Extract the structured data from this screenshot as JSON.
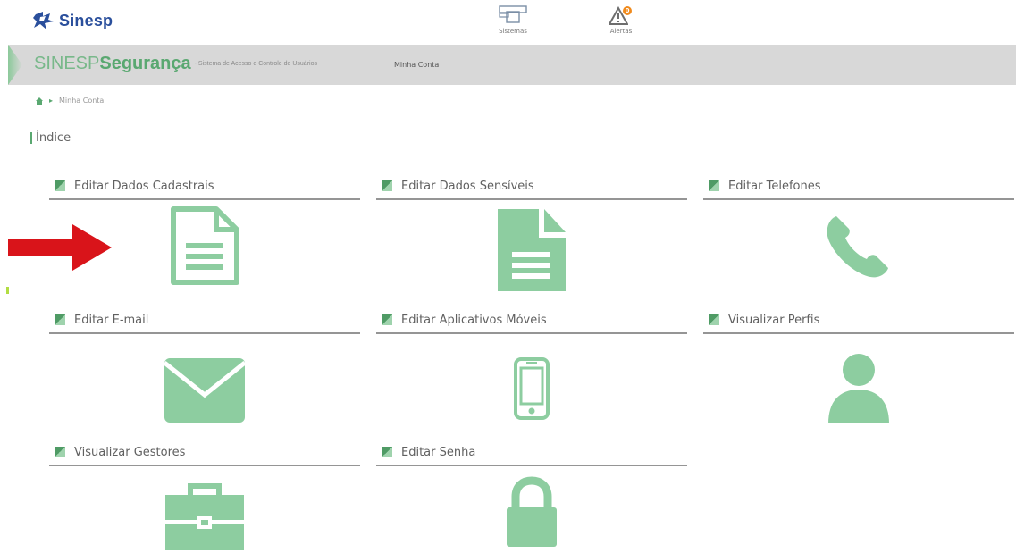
{
  "header": {
    "logo_text": "Sinesp",
    "systems_label": "Sistemas",
    "alerts_label": "Alertas",
    "alerts_count": "0"
  },
  "nav": {
    "brand_prefix": "SINESP",
    "brand_bold": "Segurança",
    "brand_subtitle": "- Sistema de Acesso e Controle de Usuários",
    "menu_item": "Minha Conta"
  },
  "breadcrumb": {
    "current": "Minha Conta"
  },
  "page": {
    "title": "Índice"
  },
  "cards": [
    {
      "label": "Editar Dados Cadastrais",
      "icon": "document-outline-icon"
    },
    {
      "label": "Editar Dados Sensíveis",
      "icon": "document-filled-icon"
    },
    {
      "label": "Editar Telefones",
      "icon": "phone-icon"
    },
    {
      "label": "Editar E-mail",
      "icon": "envelope-icon"
    },
    {
      "label": "Editar Aplicativos Móveis",
      "icon": "mobile-phone-icon"
    },
    {
      "label": "Visualizar Perfis",
      "icon": "user-icon"
    },
    {
      "label": "Visualizar Gestores",
      "icon": "briefcase-icon"
    },
    {
      "label": "Editar Senha",
      "icon": "padlock-icon"
    }
  ],
  "colors": {
    "icon_green": "#8dcda0",
    "brand_green": "#5aa871",
    "logo_blue": "#2a4f9c",
    "arrow_red": "#d9141a",
    "alert_orange": "#f08a1c"
  }
}
